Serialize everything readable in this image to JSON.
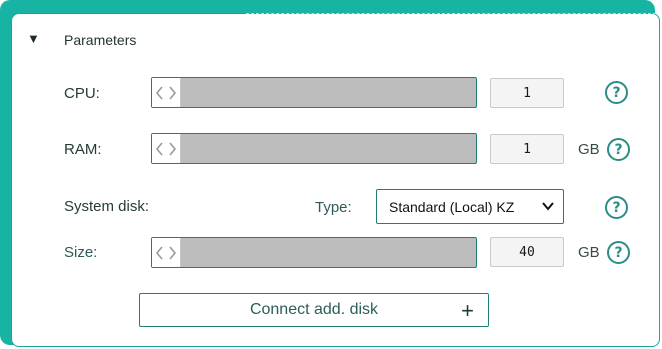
{
  "section": {
    "toggle_glyph": "▼",
    "title": "Parameters"
  },
  "cpu": {
    "label": "CPU:",
    "value": "1",
    "unit": ""
  },
  "ram": {
    "label": "RAM:",
    "value": "1",
    "unit": "GB"
  },
  "system_disk": {
    "label": "System disk:",
    "type_label": "Type:",
    "type_selected": "Standard (Local) KZ",
    "size_label": "Size:",
    "size_value": "40",
    "size_unit": "GB"
  },
  "help_glyph": "?",
  "connect_disk": {
    "label": "Connect add. disk",
    "plus_glyph": "+"
  },
  "colors": {
    "accent": "#17b3a3",
    "border": "#1f7e77",
    "track": "#bdbdbd"
  },
  "icons": {
    "toggle": "collapse-triangle-icon",
    "slider_handle": "slider-handle-arrows-icon",
    "help": "help-circle-icon",
    "select": "chevron-down-icon",
    "add": "plus-icon"
  }
}
